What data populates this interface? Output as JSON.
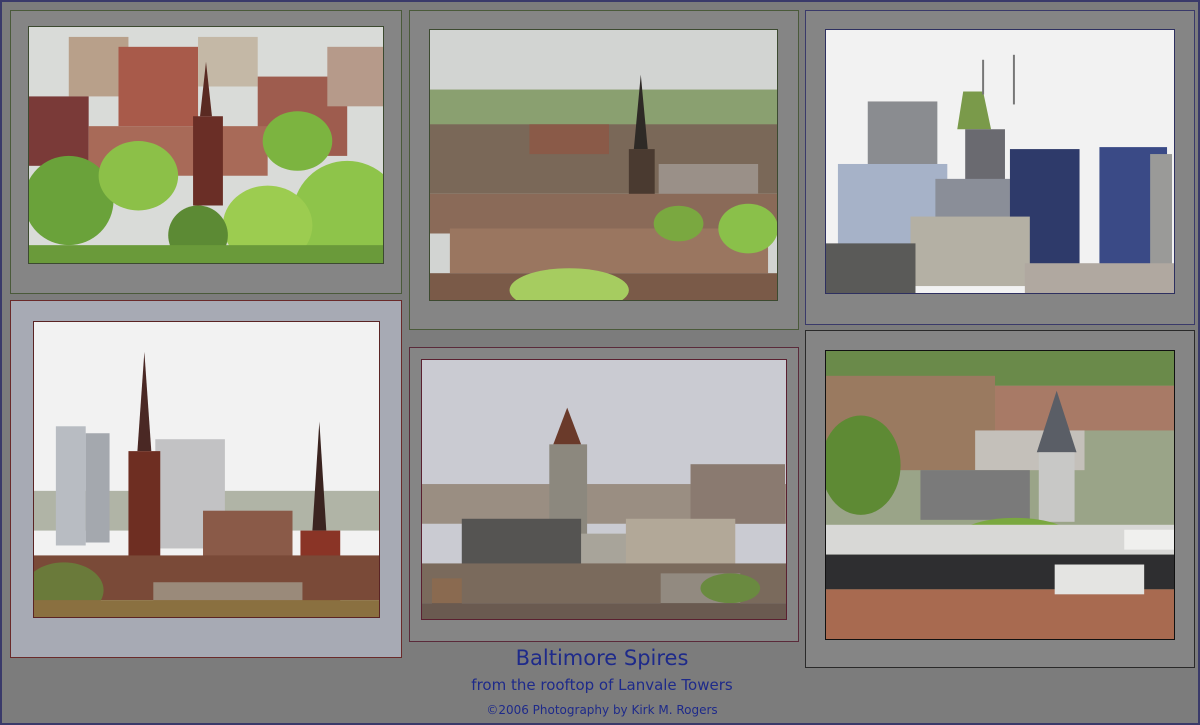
{
  "collage": {
    "title": "Baltimore Spires",
    "subtitle": "from the rooftop of Lanvale Towers",
    "credit": "©2006 Photography by Kirk M. Rogers"
  },
  "colors": {
    "background": "#7c7c7c",
    "mat_gray": "#858585",
    "mat_light": "#a7aab4",
    "caption_text": "#1e2a8a"
  },
  "photos": [
    {
      "name": "photo-gothic-spire-park",
      "subject": "gothic spire among trees"
    },
    {
      "name": "photo-rowhouses-spire",
      "subject": "rowhouses with church spire"
    },
    {
      "name": "photo-downtown-skyline",
      "subject": "downtown skyscrapers"
    },
    {
      "name": "photo-twin-spires",
      "subject": "two church spires with towers"
    },
    {
      "name": "photo-bell-tower-church",
      "subject": "stone bell tower church"
    },
    {
      "name": "photo-rooftops-turret",
      "subject": "rooftops with slate turret"
    }
  ]
}
